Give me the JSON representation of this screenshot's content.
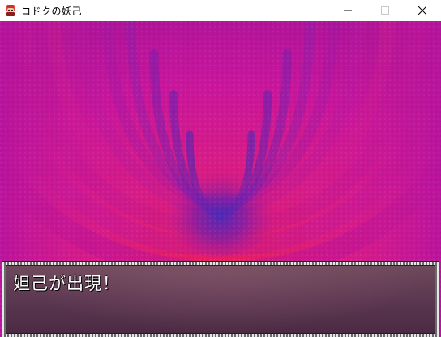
{
  "window": {
    "title": "コドクの妖己",
    "icon": "game-character-icon"
  },
  "controls": {
    "minimize_icon": "minimize-icon",
    "maximize_icon": "maximize-icon",
    "close_icon": "close-icon"
  },
  "scene": {
    "background": "psychedelic-magenta-vortex",
    "colors": {
      "outer": "#c81aa0",
      "mid": "#d8208a",
      "inner_red": "#e82060",
      "core": "#5a2ab0"
    }
  },
  "message": {
    "text": "妲己が出現！"
  }
}
